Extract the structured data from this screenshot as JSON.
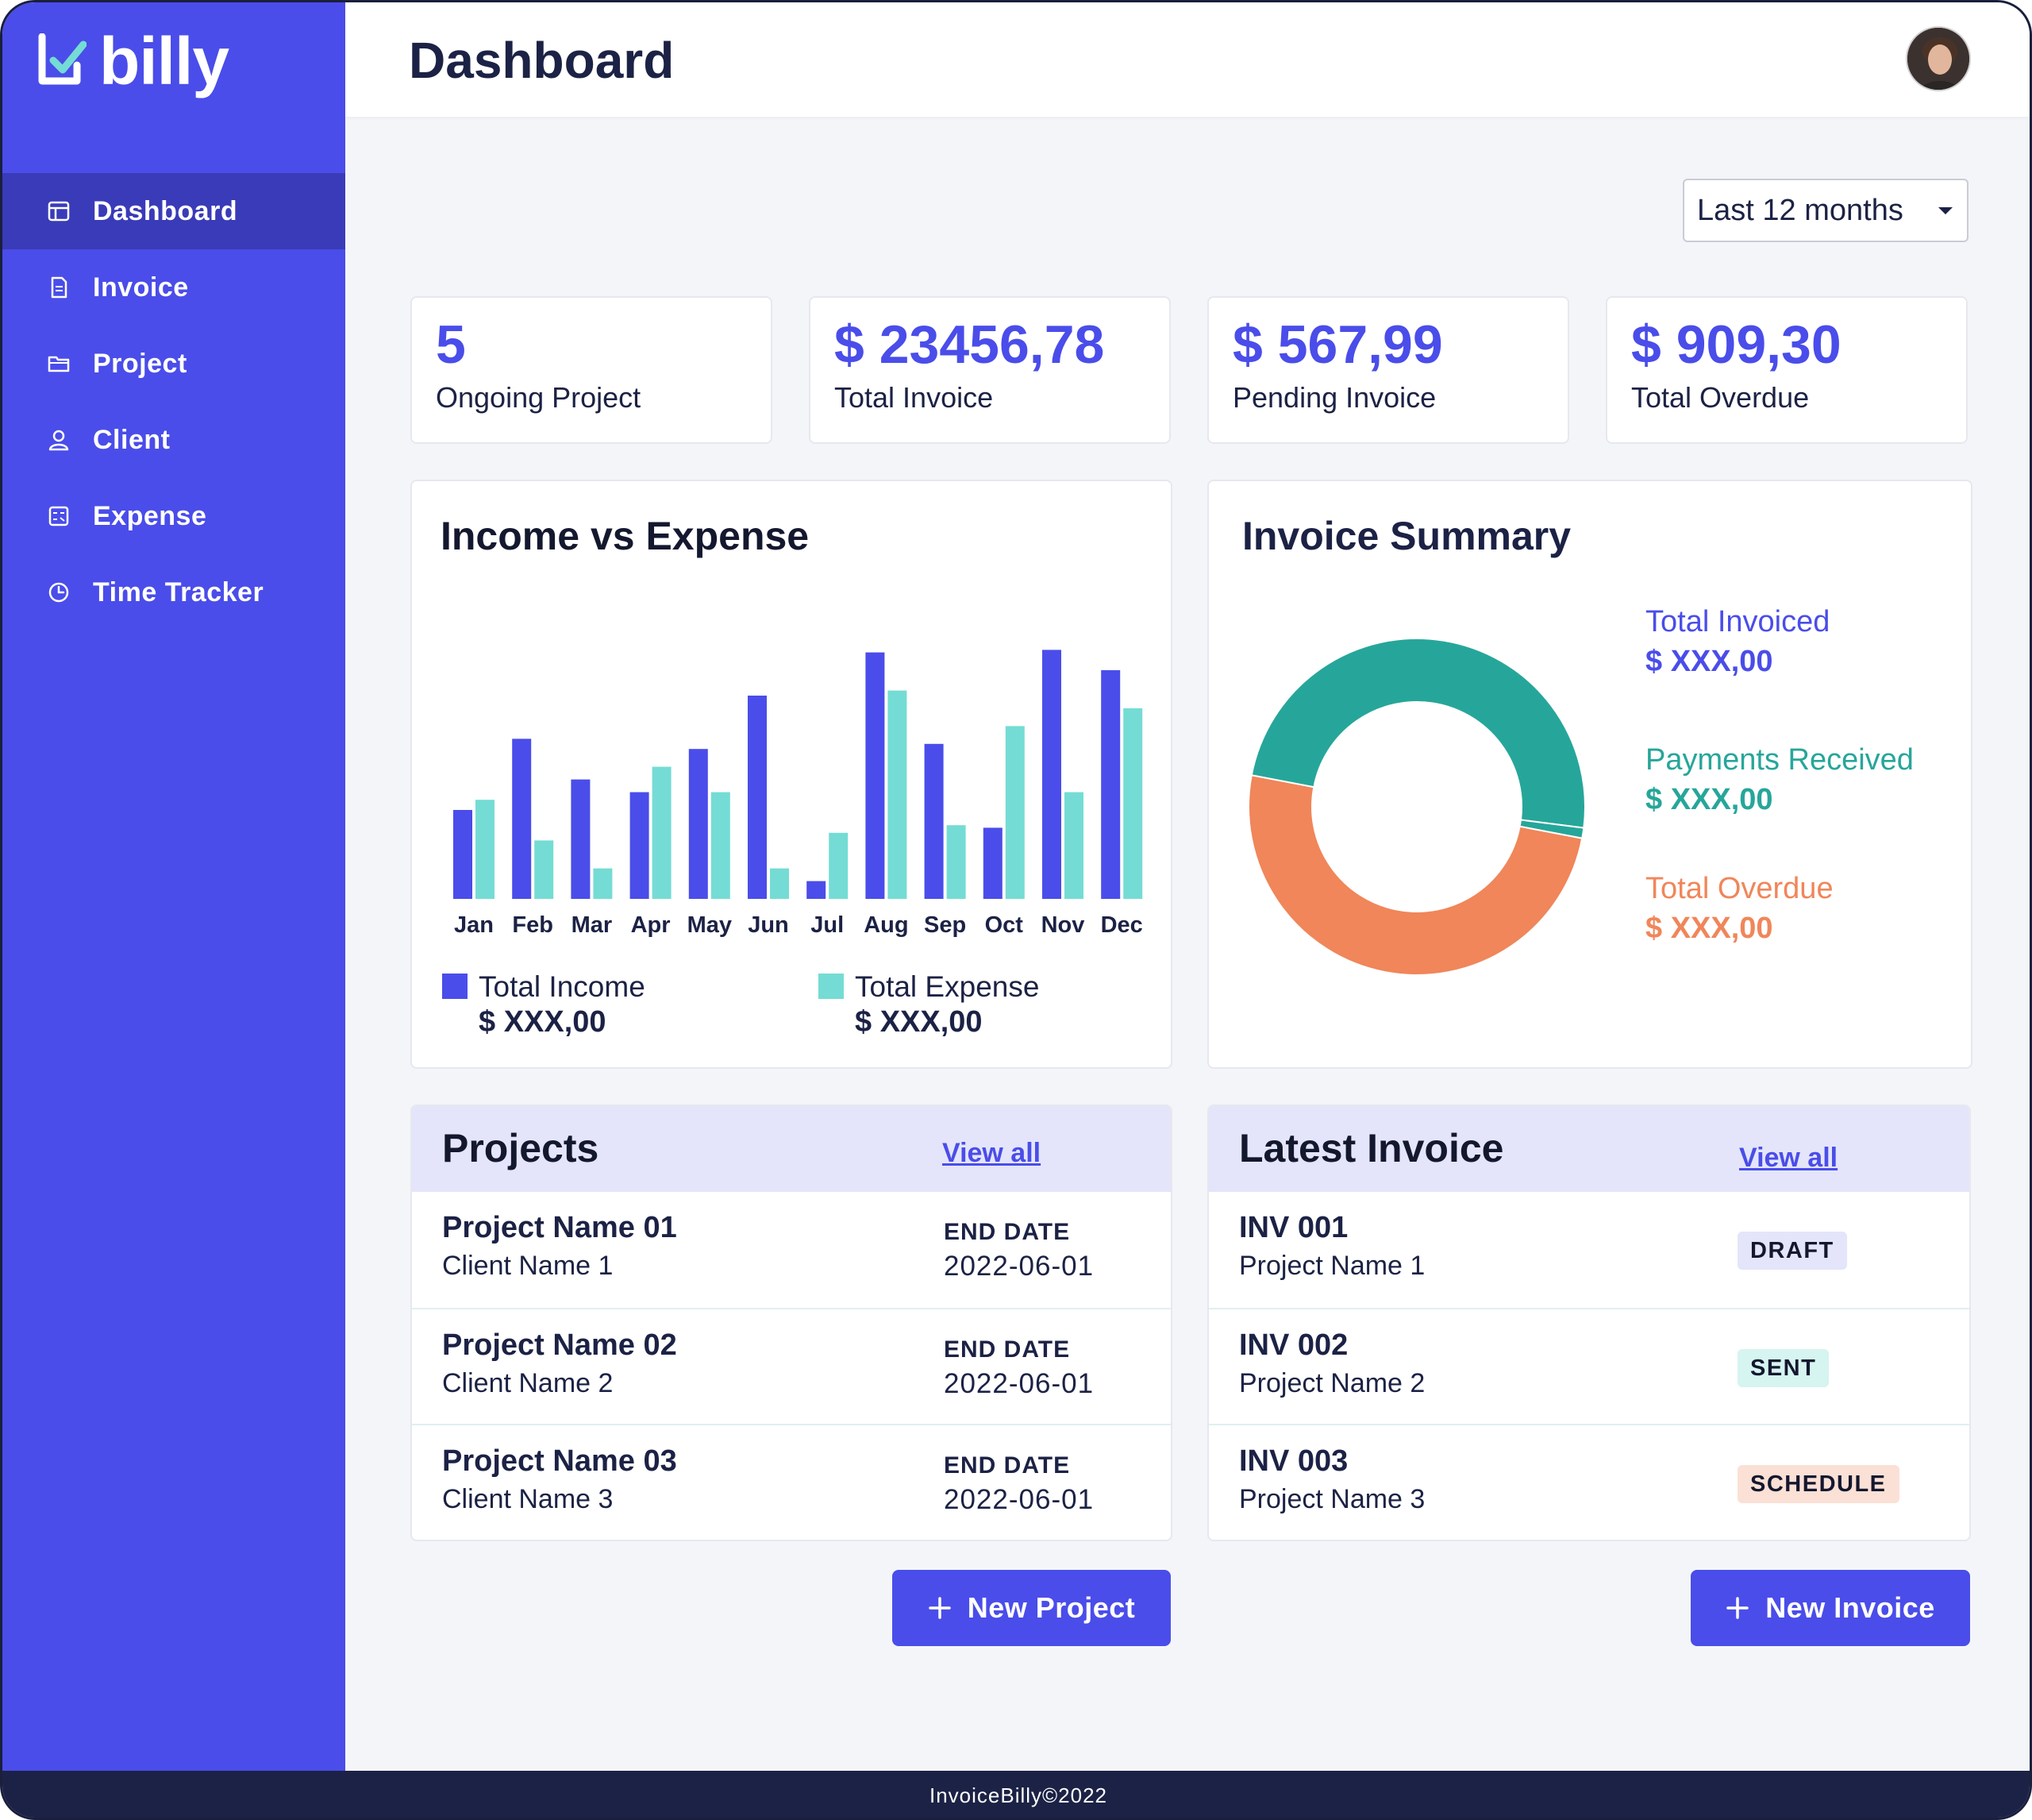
{
  "brand": {
    "name": "billy",
    "colors": {
      "primary": "#4a4de9",
      "teal": "#26a69a",
      "orange": "#f0865a",
      "light_teal": "#74dcd4"
    }
  },
  "sidebar": {
    "items": [
      {
        "label": "Dashboard",
        "icon": "dashboard-icon",
        "active": true
      },
      {
        "label": "Invoice",
        "icon": "document-icon"
      },
      {
        "label": "Project",
        "icon": "folder-icon"
      },
      {
        "label": "Client",
        "icon": "user-icon"
      },
      {
        "label": "Expense",
        "icon": "calculator-icon"
      },
      {
        "label": "Time Tracker",
        "icon": "clock-icon"
      }
    ]
  },
  "header": {
    "title": "Dashboard",
    "avatar": "user-avatar"
  },
  "filter": {
    "period": "Last 12 months"
  },
  "stats": [
    {
      "value": "5",
      "label": "Ongoing Project"
    },
    {
      "value": "$ 23456,78",
      "label": "Total Invoice"
    },
    {
      "value": "$ 567,99",
      "label": "Pending Invoice"
    },
    {
      "value": "$ 909,30",
      "label": "Total Overdue"
    }
  ],
  "income_chart": {
    "title": "Income vs Expense",
    "legend": [
      {
        "label": "Total Income",
        "value": "$ XXX,00"
      },
      {
        "label": "Total Expense",
        "value": "$ XXX,00"
      }
    ]
  },
  "invoice_summary": {
    "title": "Invoice Summary",
    "items": [
      {
        "label": "Total Invoiced",
        "value": "$ XXX,00"
      },
      {
        "label": "Payments Received",
        "value": "$ XXX,00"
      },
      {
        "label": "Total Overdue",
        "value": "$ XXX,00"
      }
    ]
  },
  "chart_data": [
    {
      "type": "bar",
      "title": "Income vs Expense",
      "categories": [
        "Jan",
        "Feb",
        "Mar",
        "Apr",
        "May",
        "Jun",
        "Jul",
        "Aug",
        "Sep",
        "Oct",
        "Nov",
        "Dec"
      ],
      "series": [
        {
          "name": "Total Income",
          "color": "#4a4de9",
          "values": [
            35,
            63,
            47,
            42,
            59,
            80,
            7,
            97,
            61,
            28,
            98,
            90
          ]
        },
        {
          "name": "Total Expense",
          "color": "#74dcd4",
          "values": [
            39,
            23,
            12,
            52,
            42,
            12,
            26,
            82,
            29,
            68,
            42,
            75
          ]
        }
      ],
      "ylim": [
        0,
        100
      ],
      "grid": false,
      "legend": "bottom"
    },
    {
      "type": "pie",
      "title": "Invoice Summary",
      "labels": [
        "Total Invoiced",
        "Payments Received",
        "Total Overdue"
      ],
      "values": [
        49,
        1,
        50
      ],
      "colors": [
        "#26a69a",
        "#26a69a",
        "#f0865a"
      ],
      "donut": true,
      "legend": "right"
    }
  ],
  "projects": {
    "title": "Projects",
    "view_all": "View all",
    "date_label": "END DATE",
    "rows": [
      {
        "name": "Project Name 01",
        "client": "Client Name 1",
        "end_date": "2022-06-01"
      },
      {
        "name": "Project Name 02",
        "client": "Client Name 2",
        "end_date": "2022-06-01"
      },
      {
        "name": "Project Name 03",
        "client": "Client Name 3",
        "end_date": "2022-06-01"
      }
    ],
    "new_button": "New Project"
  },
  "invoices": {
    "title": "Latest Invoice",
    "view_all": "View all",
    "rows": [
      {
        "number": "INV 001",
        "project": "Project Name 1",
        "status": "DRAFT",
        "status_color": "#e4e5fa"
      },
      {
        "number": "INV 002",
        "project": "Project Name 2",
        "status": "SENT",
        "status_color": "#d6f4f0"
      },
      {
        "number": "INV 003",
        "project": "Project Name 3",
        "status": "SCHEDULE",
        "status_color": "#fbe0d5"
      }
    ],
    "new_button": "New Invoice"
  },
  "footer": {
    "text": "InvoiceBilly©2022"
  }
}
